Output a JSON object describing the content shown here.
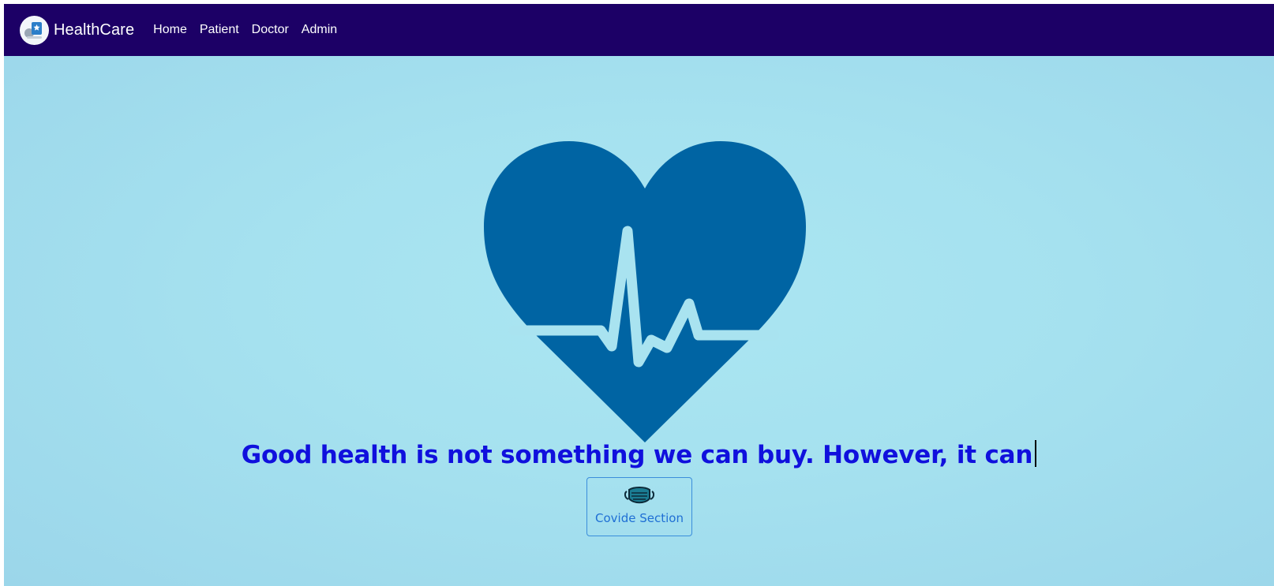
{
  "navbar": {
    "brand": "HealthCare",
    "links": [
      "Home",
      "Patient",
      "Doctor",
      "Admin"
    ]
  },
  "hero": {
    "tagline": "Good health is not something we can buy. However, it can",
    "covid_button_label": "Covide Section",
    "icons": {
      "logo": "healthcare-logo-icon",
      "heart": "heartbeat-icon",
      "mask": "face-mask-icon"
    }
  },
  "colors": {
    "navbar_bg": "#1c0066",
    "hero_bg": "#a5e1ef",
    "heart": "#0064a3",
    "tagline": "#1010dd",
    "button_border": "#3a8ddb",
    "button_text": "#1f6fd4"
  }
}
